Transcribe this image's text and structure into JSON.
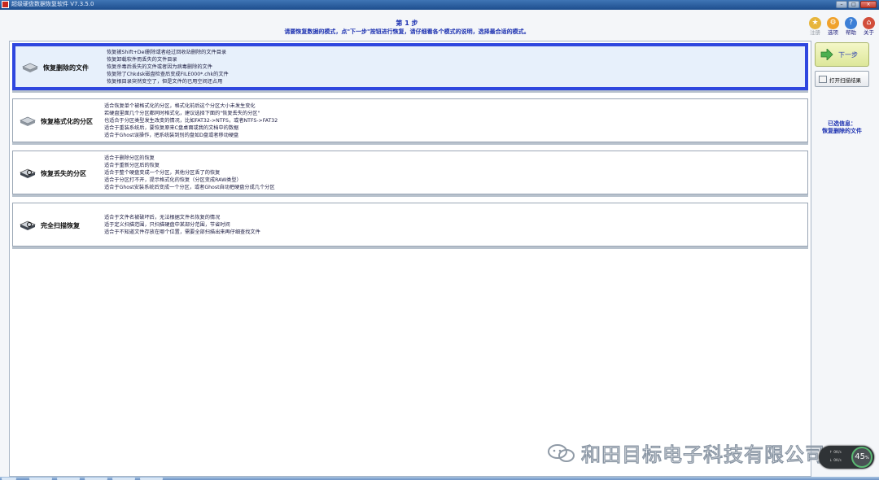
{
  "window": {
    "title": "超级硬盘数据恢复软件 V7.3.5.0",
    "controls": [
      "minimize",
      "maximize",
      "close"
    ]
  },
  "header": {
    "step_title": "第 1 步",
    "step_desc": "请要恢复数据的模式，点\"下一步\"按钮进行恢复，请仔细看各个模式的说明，选择最合适的模式。"
  },
  "toolbar": [
    {
      "label": "注册",
      "icon": "cart-icon",
      "disabled": true
    },
    {
      "label": "选项",
      "icon": "gear-icon",
      "disabled": false
    },
    {
      "label": "帮助",
      "icon": "help-icon",
      "disabled": false
    },
    {
      "label": "关于",
      "icon": "house-icon",
      "disabled": false
    }
  ],
  "modes": [
    {
      "title": "恢复删除的文件",
      "icon": "disk-icon",
      "selected": true,
      "desc": [
        "恢复被Shift+Del删除或者经过回收站删除的文件目录",
        "恢复卸载软件而丢失的文件目录",
        "恢复杀毒后丢失的文件或者因为病毒删除的文件",
        "恢复除了Chkdsk磁盘检查后变成FILE000*.chk的文件",
        "恢复根目录突然变空了，但是文件的已用空间还占用"
      ]
    },
    {
      "title": "恢复格式化的分区",
      "icon": "disk-icon",
      "selected": false,
      "desc": [
        "适合恢复单个被格式化的分区，格式化前后这个分区大小未发生变化",
        "若硬盘里面几个分区都同时格式化，建议选择下面的\"恢复丢失的分区\"",
        "也适合于分区类型发生改变的情况，比如FAT32->NTFS，或者NTFS->FAT32",
        "适合于重装系统后，要恢复原来C盘桌面或我的文档中的数据",
        "适合于Ghost误操作，把系统装到别的盘如D盘或者移动硬盘"
      ]
    },
    {
      "title": "恢复丢失的分区",
      "icon": "disk-search-icon",
      "selected": false,
      "desc": [
        "适合于删除分区的恢复",
        "适合于重新分区后的恢复",
        "适合于整个硬盘变成一个分区，其他分区丢了的恢复",
        "适合于分区打不开，提示格式化的恢复（分区变成RAW类型）",
        "适合于Ghost安装系统后变成一个分区，或者Ghost自动把硬盘分成几个分区"
      ]
    },
    {
      "title": "完全扫描恢复",
      "icon": "disk-search-icon",
      "selected": false,
      "desc": [
        "适合于文件名被破坏后，无法根据文件名恢复的情况",
        "适于定义扫描范围，只扫描硬盘中某部分范围，节省时间",
        "适合于不知道文件存放在哪个位置，需要全部扫描出来再仔细查找文件"
      ]
    }
  ],
  "side": {
    "next_label": "下一步",
    "open_scan_label": "打开扫描结果",
    "selected_info_label": "已选信息：",
    "selected_info_value": "恢复删除的文件"
  },
  "watermark": {
    "text": "和田目标电子科技有限公司",
    "icon": "wechat-icon"
  },
  "speed_widget": {
    "up": "0K/s",
    "down": "0K/s",
    "percent": "45",
    "percent_unit": "%"
  },
  "colors": {
    "accent_blue": "#2f47df",
    "title_text": "#1a2fb0",
    "next_button": "#dde79a",
    "gauge_ring": "#5ab872"
  }
}
